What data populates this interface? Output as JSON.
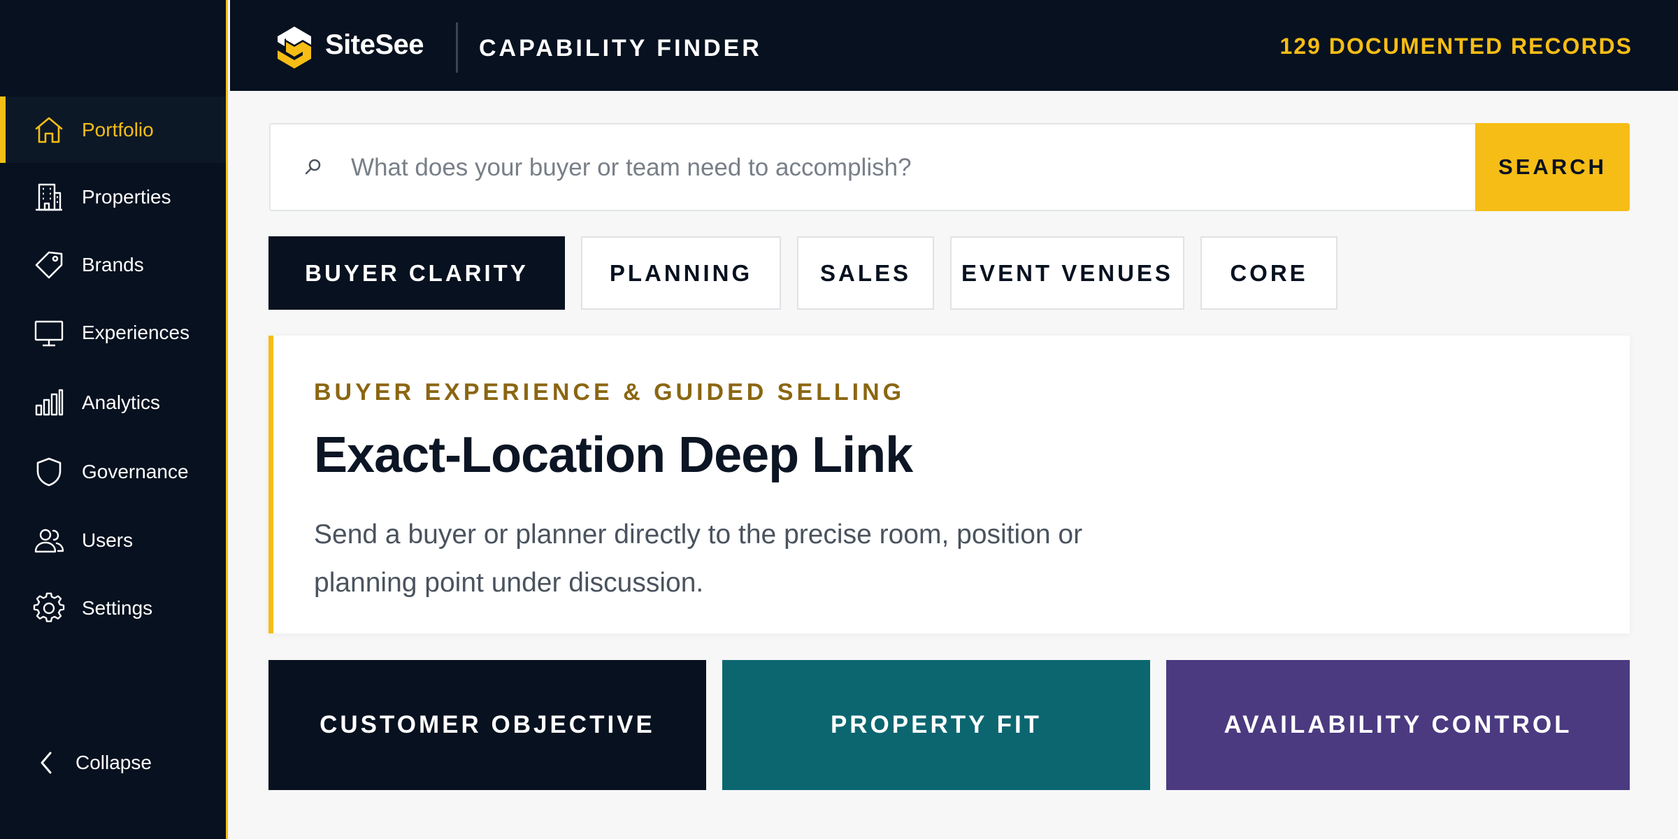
{
  "header": {
    "brand": "SiteSee",
    "title": "CAPABILITY FINDER",
    "records": "129 DOCUMENTED RECORDS",
    "logo_icon": "sitesee-logo-icon"
  },
  "sidebar": {
    "items": [
      {
        "label": "Portfolio",
        "icon": "home-icon",
        "active": true
      },
      {
        "label": "Properties",
        "icon": "building-icon",
        "active": false
      },
      {
        "label": "Brands",
        "icon": "tag-icon",
        "active": false
      },
      {
        "label": "Experiences",
        "icon": "monitor-icon",
        "active": false
      },
      {
        "label": "Analytics",
        "icon": "bar-chart-icon",
        "active": false
      },
      {
        "label": "Governance",
        "icon": "shield-icon",
        "active": false
      },
      {
        "label": "Users",
        "icon": "users-icon",
        "active": false
      },
      {
        "label": "Settings",
        "icon": "gear-icon",
        "active": false
      }
    ],
    "collapse_label": "Collapse"
  },
  "search": {
    "placeholder": "What does your buyer or team need to accomplish?",
    "value": "",
    "button_label": "SEARCH"
  },
  "tabs": [
    {
      "label": "BUYER CLARITY",
      "active": true
    },
    {
      "label": "PLANNING",
      "active": false
    },
    {
      "label": "SALES",
      "active": false
    },
    {
      "label": "EVENT VENUES",
      "active": false
    },
    {
      "label": "CORE",
      "active": false
    }
  ],
  "card": {
    "category": "BUYER EXPERIENCE & GUIDED SELLING",
    "title": "Exact-Location Deep Link",
    "description": "Send a buyer or planner directly to the precise room, position or planning point under discussion."
  },
  "tiles": [
    {
      "label": "CUSTOMER OBJECTIVE",
      "color": "#07111f"
    },
    {
      "label": "PROPERTY FIT",
      "color": "#0b6670"
    },
    {
      "label": "AVAILABILITY CONTROL",
      "color": "#4b3a80"
    }
  ],
  "colors": {
    "accent": "#f6bd16",
    "dark": "#07111f",
    "category_text": "#8b6612"
  }
}
